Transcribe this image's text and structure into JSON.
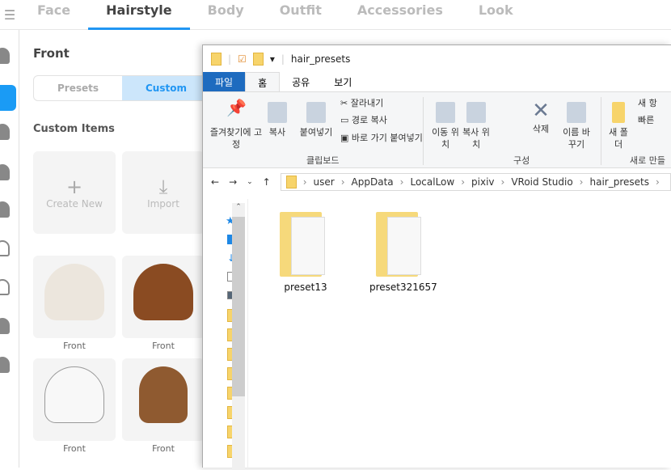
{
  "app": {
    "tabs": [
      "Face",
      "Hairstyle",
      "Body",
      "Outfit",
      "Accessories",
      "Look"
    ],
    "active_tab": "Hairstyle"
  },
  "panel": {
    "title": "Front",
    "segments": [
      "Presets",
      "Custom"
    ],
    "active_segment": "Custom",
    "section": "Custom Items",
    "actions": [
      {
        "label": "Create New",
        "icon": "plus-icon"
      },
      {
        "label": "Import",
        "icon": "import-icon"
      }
    ],
    "items": [
      {
        "label": "Front",
        "color": "#ece6dd"
      },
      {
        "label": "Front",
        "color": "#8a4b22"
      },
      {
        "label": "Front",
        "color": "#f8f8f8"
      },
      {
        "label": "Front",
        "color": "#8f5a30"
      }
    ]
  },
  "explorer": {
    "title": "hair_presets",
    "ribbon_tabs": [
      "파일",
      "홈",
      "공유",
      "보기"
    ],
    "clipboard": {
      "pin": "즐겨찾기에 고정",
      "copy": "복사",
      "paste": "붙여넣기",
      "cut": "잘라내기",
      "copy_path": "경로 복사",
      "paste_shortcut": "바로 가기 붙여넣기",
      "group": "클립보드"
    },
    "organize": {
      "move": "이동 위치",
      "copy_to": "복사 위치",
      "delete": "삭제",
      "rename": "이름 바꾸기",
      "group": "구성"
    },
    "new": {
      "folder": "새 폴더",
      "new_item": "새 항",
      "easy_access": "빠른",
      "group": "새로 만들"
    },
    "path": [
      "user",
      "AppData",
      "LocalLow",
      "pixiv",
      "VRoid Studio",
      "hair_presets"
    ],
    "files": [
      "preset13",
      "preset321657"
    ]
  },
  "colors": {
    "accent": "#2196f3",
    "file_tab": "#1e6bbf",
    "folder": "#f7d46b"
  }
}
